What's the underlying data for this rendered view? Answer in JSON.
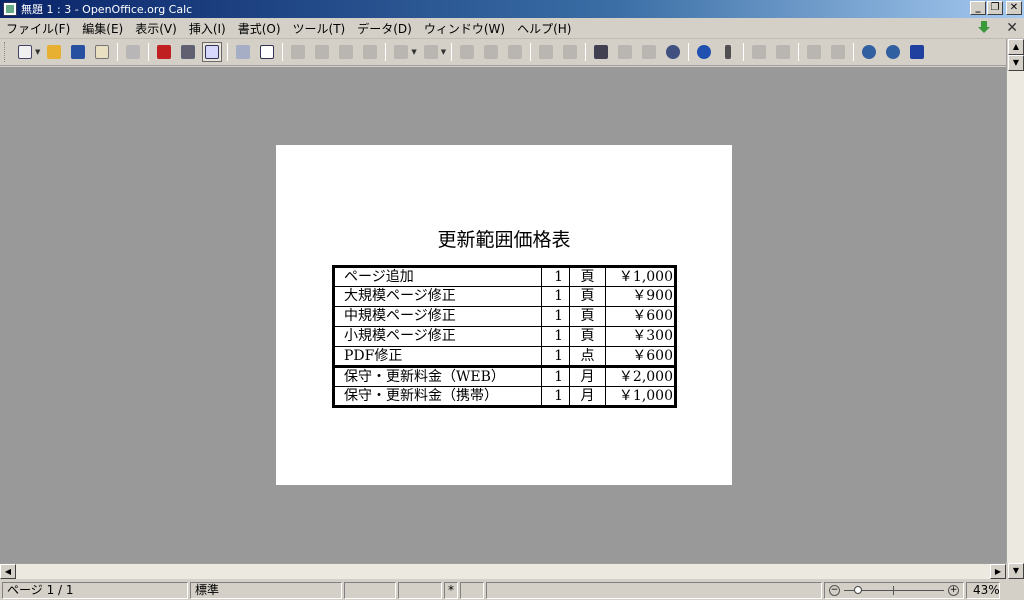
{
  "window": {
    "title": "無題 1 : 3 - OpenOffice.org Calc"
  },
  "menu": [
    "ファイル(F)",
    "編集(E)",
    "表示(V)",
    "挿入(I)",
    "書式(O)",
    "ツール(T)",
    "データ(D)",
    "ウィンドウ(W)",
    "ヘルプ(H)"
  ],
  "document": {
    "title": "更新範囲価格表",
    "rows": [
      {
        "name": "ページ追加",
        "qty": "1",
        "unit": "頁",
        "price": "￥1,000"
      },
      {
        "name": "大規模ページ修正",
        "qty": "1",
        "unit": "頁",
        "price": "￥900"
      },
      {
        "name": "中規模ページ修正",
        "qty": "1",
        "unit": "頁",
        "price": "￥600"
      },
      {
        "name": "小規模ページ修正",
        "qty": "1",
        "unit": "頁",
        "price": "￥300"
      },
      {
        "name": "PDF修正",
        "qty": "1",
        "unit": "点",
        "price": "￥600"
      },
      {
        "name": "保守・更新料金（WEB）",
        "qty": "1",
        "unit": "月",
        "price": "￥2,000"
      },
      {
        "name": "保守・更新料金（携帯）",
        "qty": "1",
        "unit": "月",
        "price": "￥1,000"
      }
    ]
  },
  "status": {
    "page": "ページ 1 / 1",
    "style": "標準",
    "modified": "*",
    "zoom": "43%"
  },
  "colors": {
    "workspace": "#999999",
    "page": "#ffffff",
    "titlebar": "#0a246a"
  }
}
